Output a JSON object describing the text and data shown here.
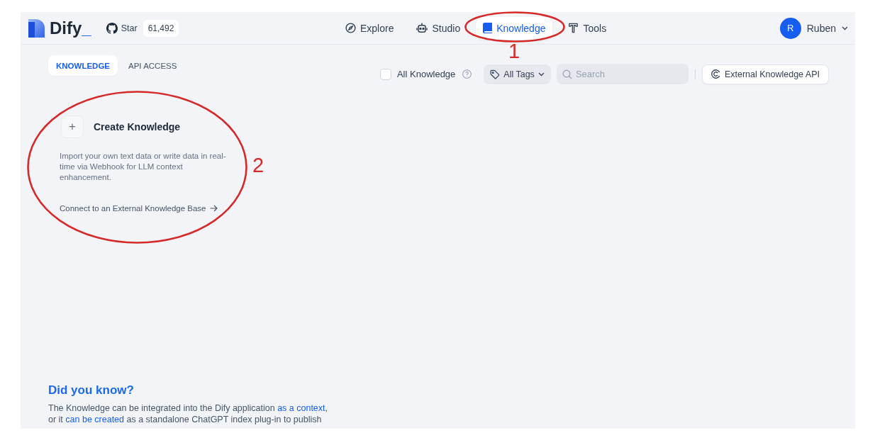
{
  "header": {
    "logo": {
      "name": "Dify",
      "mark": "_"
    },
    "github": {
      "label": "Star",
      "count": "61,492"
    },
    "nav": [
      {
        "label": "Explore",
        "selected": false
      },
      {
        "label": "Studio",
        "selected": false
      },
      {
        "label": "Knowledge",
        "selected": true
      },
      {
        "label": "Tools",
        "selected": false
      }
    ],
    "user": {
      "initial": "R",
      "name": "Ruben"
    }
  },
  "tabs": [
    {
      "label": "KNOWLEDGE",
      "selected": true
    },
    {
      "label": "API ACCESS",
      "selected": false
    }
  ],
  "filters": {
    "all_knowledge": {
      "label": "All Knowledge",
      "checked": false
    },
    "tags": {
      "label": "All Tags"
    },
    "search": {
      "placeholder": "Search"
    },
    "external_api_button": {
      "label": "External Knowledge API"
    }
  },
  "create_card": {
    "icon": "+",
    "title": "Create Knowledge",
    "description": "Import your own text data or write data in real-time via Webhook for LLM context enhancement.",
    "link": "Connect to an External Knowledge Base"
  },
  "tip": {
    "title": "Did you know?",
    "lines": [
      [
        {
          "kind": "text",
          "text": "The Knowledge can be integrated into the Dify application "
        },
        {
          "kind": "link",
          "text": "as a context"
        },
        {
          "kind": "text",
          "text": ","
        }
      ],
      [
        {
          "kind": "text",
          "text": "or it "
        },
        {
          "kind": "link",
          "text": "can be created"
        },
        {
          "kind": "text",
          "text": " as a standalone ChatGPT index plug-in to publish"
        }
      ]
    ]
  },
  "annotations": [
    {
      "label": "1"
    },
    {
      "label": "2"
    }
  ]
}
